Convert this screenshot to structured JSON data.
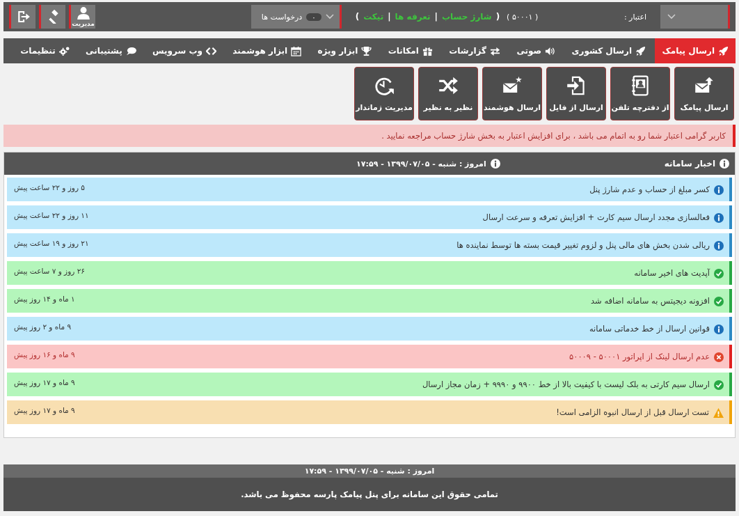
{
  "header": {
    "credit_label": "اعتبار :",
    "credit_value": "( ۵۰۰۰۱ )",
    "account_links": {
      "open": "(",
      "items": [
        "شارژ حساب",
        "تعرفه ها",
        "تیکت"
      ],
      "separators": [
        "|",
        "|"
      ],
      "close": ")"
    },
    "requests": {
      "count": "۰",
      "label": "درخواست ها"
    },
    "admin_label": "مدیریت"
  },
  "nav": [
    {
      "label": "ارسال پیامک",
      "selected": true
    },
    {
      "label": "ارسال کشوری",
      "selected": false
    },
    {
      "label": "صوتی",
      "selected": false
    },
    {
      "label": "گزارشات",
      "selected": false
    },
    {
      "label": "امکانات",
      "selected": false
    },
    {
      "label": "ابزار ویژه",
      "selected": false
    },
    {
      "label": "ابزار هوشمند",
      "selected": false
    },
    {
      "label": "وب سرویس",
      "selected": false
    },
    {
      "label": "پشتیبانی",
      "selected": false
    },
    {
      "label": "تنظیمات",
      "selected": false
    }
  ],
  "shortcuts": [
    "ارسال پیامک",
    "از دفترچه تلفن",
    "ارسال از فایل",
    "ارسال هوشمند",
    "نظیر به نظیر",
    "مدیریت زماندار"
  ],
  "alert": "کاربر گرامی اعتبار شما رو به اتمام می باشد ، برای افزایش اعتبار به بخش شارژ حساب مراجعه نمایید .",
  "news": {
    "title": "اخبار سامانه",
    "date": "امروز : شنبه - ۱۳۹۹/۰۷/۰۵ - ۱۷:۵۹",
    "items": [
      {
        "kind": "info",
        "title": "کسر مبلغ از حساب و عدم شارژ پنل",
        "time": "۵ روز و ۲۲ ساعت پیش"
      },
      {
        "kind": "info",
        "title": "فعالسازی مجدد ارسال سیم کارت + افزایش تعرفه و سرعت ارسال",
        "time": "۱۱ روز و ۲۲ ساعت پیش"
      },
      {
        "kind": "info",
        "title": "ریالی شدن بخش های مالی پنل و لزوم تغییر قیمت بسته ها توسط نماینده ها",
        "time": "۲۱ روز و ۱۹ ساعت پیش"
      },
      {
        "kind": "success",
        "title": "آپدیت های اخیر سامانه",
        "time": "۲۶ روز و ۷ ساعت پیش"
      },
      {
        "kind": "success",
        "title": "افزونه دیجیتس به سامانه اضافه شد",
        "time": "۱ ماه و ۱۴ روز پیش"
      },
      {
        "kind": "info",
        "title": "قوانین ارسال از خط خدماتی سامانه",
        "time": "۹ ماه و ۲ روز پیش"
      },
      {
        "kind": "error",
        "title": "عدم ارسال لینک از اپراتور ۵۰۰۰۱ - ۵۰۰۰۹",
        "time": "۹ ماه و ۱۶ روز پیش"
      },
      {
        "kind": "success",
        "title": "ارسال سیم کارتی به بلک لیست با کیفیت بالا از خط ۹۹۰۰ و ۹۹۹۰ + زمان مجاز ارسال",
        "time": "۹ ماه و ۱۷ روز پیش"
      },
      {
        "kind": "warning",
        "title": "تست ارسال قبل از ارسال انبوه الزامی است!",
        "time": "۹ ماه و ۱۷ روز پیش"
      }
    ]
  },
  "footer": {
    "date": "امروز : شنبه - ۱۳۹۹/۰۷/۰۵ - ۱۷:۵۹",
    "copyright": "تمامی حقوق این سامانه برای پنل پیامک پارسه محفوظ می باشد."
  }
}
